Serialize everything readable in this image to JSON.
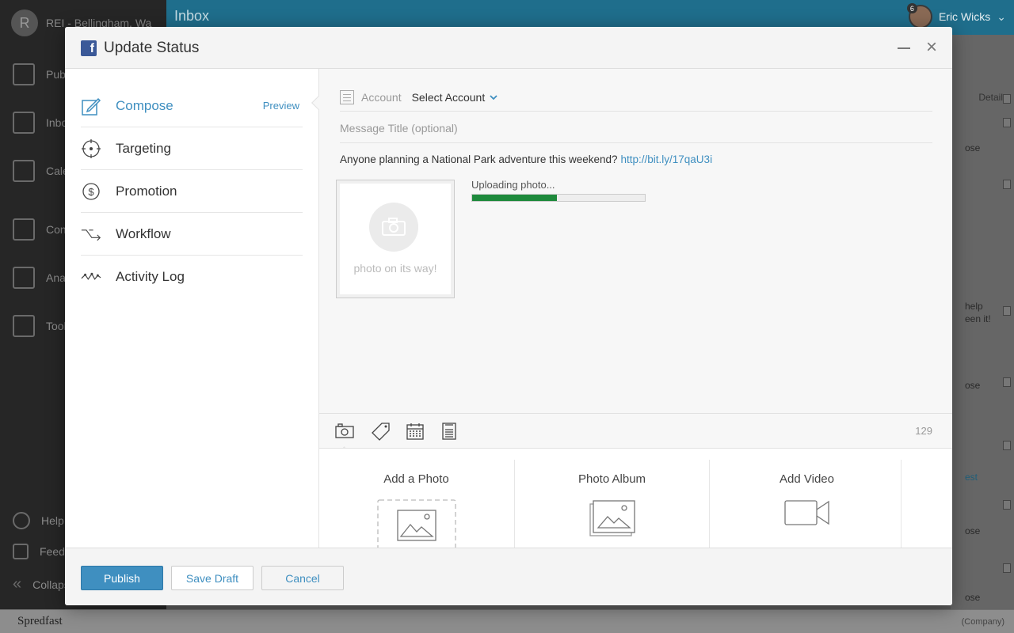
{
  "background": {
    "brand_initial": "R",
    "brand_name": "REI - Bellingham, Wa",
    "nav": [
      {
        "label": "Publish",
        "icon": "publish-icon"
      },
      {
        "label": "Inbox",
        "icon": "inbox-icon"
      },
      {
        "label": "Calendar",
        "icon": "calendar-icon"
      },
      {
        "label": "Content",
        "icon": "content-icon"
      },
      {
        "label": "Analytics",
        "icon": "analytics-icon"
      },
      {
        "label": "Tools",
        "icon": "tools-icon"
      }
    ],
    "bottom_nav": [
      {
        "label": "Help",
        "icon": "help-icon"
      },
      {
        "label": "Feedback",
        "icon": "feedback-icon"
      },
      {
        "label": "Collapse",
        "icon": "collapse-icon"
      }
    ],
    "topbar_title": "Inbox",
    "user_name": "Eric Wicks",
    "user_badge": "6",
    "right_column_header": "Details",
    "right_column_snippets": [
      "ose",
      "help",
      "een it!",
      "ose",
      "est",
      "ose",
      "ose"
    ],
    "footer_brand": "Spredfast",
    "footer_company": "(Company)"
  },
  "modal": {
    "title": "Update Status",
    "sidebar": [
      {
        "label": "Compose",
        "icon": "compose-icon",
        "active": true
      },
      {
        "label": "Targeting",
        "icon": "targeting-icon",
        "active": false
      },
      {
        "label": "Promotion",
        "icon": "promotion-icon",
        "active": false
      },
      {
        "label": "Workflow",
        "icon": "workflow-icon",
        "active": false
      },
      {
        "label": "Activity Log",
        "icon": "activity-log-icon",
        "active": false
      }
    ],
    "preview_label": "Preview",
    "account": {
      "label": "Account",
      "value": "Select Account"
    },
    "message_title": {
      "placeholder": "Message Title (optional)",
      "value": ""
    },
    "message": {
      "text": "Anyone planning a National Park adventure this weekend?",
      "link": "http://bit.ly/17qaU3i"
    },
    "photo_placeholder_caption": "photo on its way!",
    "upload": {
      "label": "Uploading photo...",
      "progress": 0.49
    },
    "toolbar": {
      "tools": [
        "photo-icon",
        "tag-icon",
        "calendar-icon",
        "notes-icon"
      ],
      "char_count": "129"
    },
    "media_options": [
      {
        "label": "Add a Photo",
        "icon": "add-photo-icon"
      },
      {
        "label": "Photo Album",
        "icon": "photo-album-icon"
      },
      {
        "label": "Add Video",
        "icon": "add-video-icon"
      }
    ],
    "footer": {
      "publish": "Publish",
      "save_draft": "Save Draft",
      "cancel": "Cancel"
    }
  },
  "colors": {
    "accent": "#3f8fc0",
    "progress": "#1e8a3c",
    "facebook": "#3b5998"
  }
}
